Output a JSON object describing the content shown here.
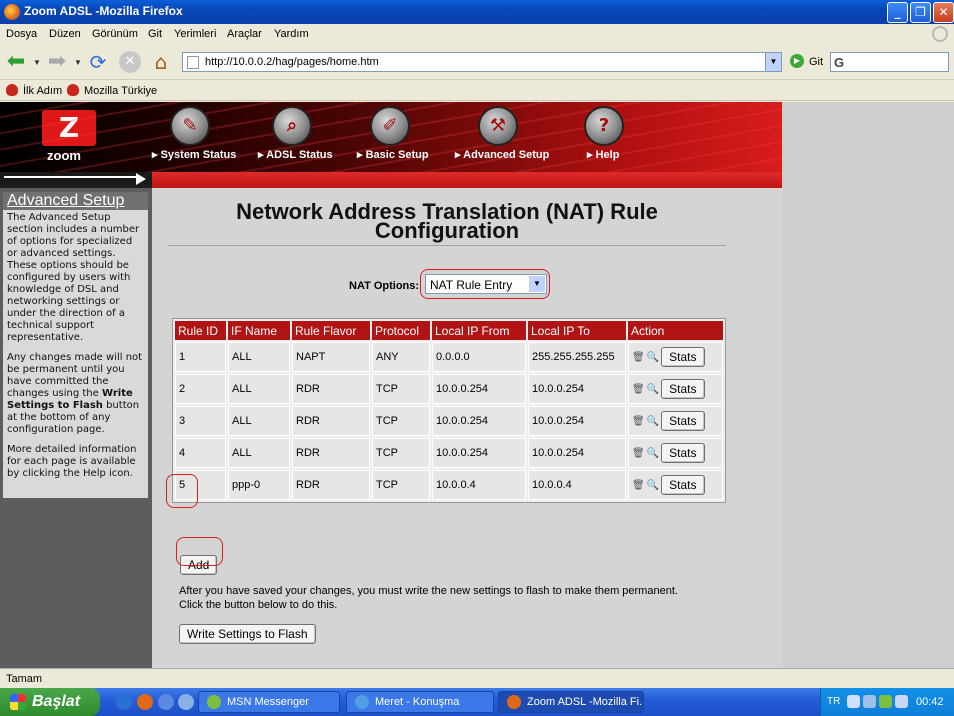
{
  "window": {
    "title": "Zoom ADSL -Mozilla Firefox"
  },
  "menu": [
    "Dosya",
    "Düzen",
    "Görünüm",
    "Git",
    "Yerimleri",
    "Araçlar",
    "Yardım"
  ],
  "nav": {
    "url": "http://10.0.0.2/hag/pages/home.htm",
    "go_label": "Git"
  },
  "bookmarks": [
    "İlk Adım",
    "Mozilla Türkiye"
  ],
  "zoom": {
    "logo_text": "zoom",
    "nav_items": [
      "System Status",
      "ADSL Status",
      "Basic Setup",
      "Advanced Setup",
      "Help"
    ]
  },
  "sidebar": {
    "title": "Advanced Setup",
    "p1": "The Advanced Setup section includes a number of options for specialized or advanced settings. These options should be configured by users with knowledge of DSL and networking settings or under the direction of a technical support representative.",
    "p2_pre": "Any changes made will not be permanent until you have committed the changes using the ",
    "p2_bold": "Write Settings to Flash",
    "p2_post": " button at the bottom of any configuration page.",
    "p3": "More detailed information for each page is available by clicking the Help icon."
  },
  "page": {
    "title_line1": "Network Address Translation (NAT) Rule",
    "title_line2": "Configuration",
    "nat_options_label": "NAT Options:",
    "nat_options_value": "NAT Rule Entry"
  },
  "table": {
    "headers": [
      "Rule ID",
      "IF Name",
      "Rule Flavor",
      "Protocol",
      "Local IP From",
      "Local IP To",
      "Action"
    ],
    "rows": [
      [
        "1",
        "ALL",
        "NAPT",
        "ANY",
        "0.0.0.0",
        "255.255.255.255"
      ],
      [
        "2",
        "ALL",
        "RDR",
        "TCP",
        "10.0.0.254",
        "10.0.0.254"
      ],
      [
        "3",
        "ALL",
        "RDR",
        "TCP",
        "10.0.0.254",
        "10.0.0.254"
      ],
      [
        "4",
        "ALL",
        "RDR",
        "TCP",
        "10.0.0.254",
        "10.0.0.254"
      ],
      [
        "5",
        "ppp-0",
        "RDR",
        "TCP",
        "10.0.0.4",
        "10.0.0.4"
      ]
    ],
    "stats_label": "Stats"
  },
  "buttons": {
    "add": "Add",
    "write": "Write Settings to Flash"
  },
  "note": {
    "line1": "After you have saved your changes, you must write the new settings to flash to make them permanent.",
    "line2": "Click the button below to do this."
  },
  "status": "Tamam",
  "taskbar": {
    "start": "Başlat",
    "tasks": [
      "MSN Messenger",
      "Meret - Konuşma",
      "Zoom ADSL -Mozilla Fi..."
    ],
    "lang": "TR",
    "clock": "00:42"
  },
  "colors": {
    "accent_red": "#b01414",
    "highlight_red": "#d42020"
  }
}
